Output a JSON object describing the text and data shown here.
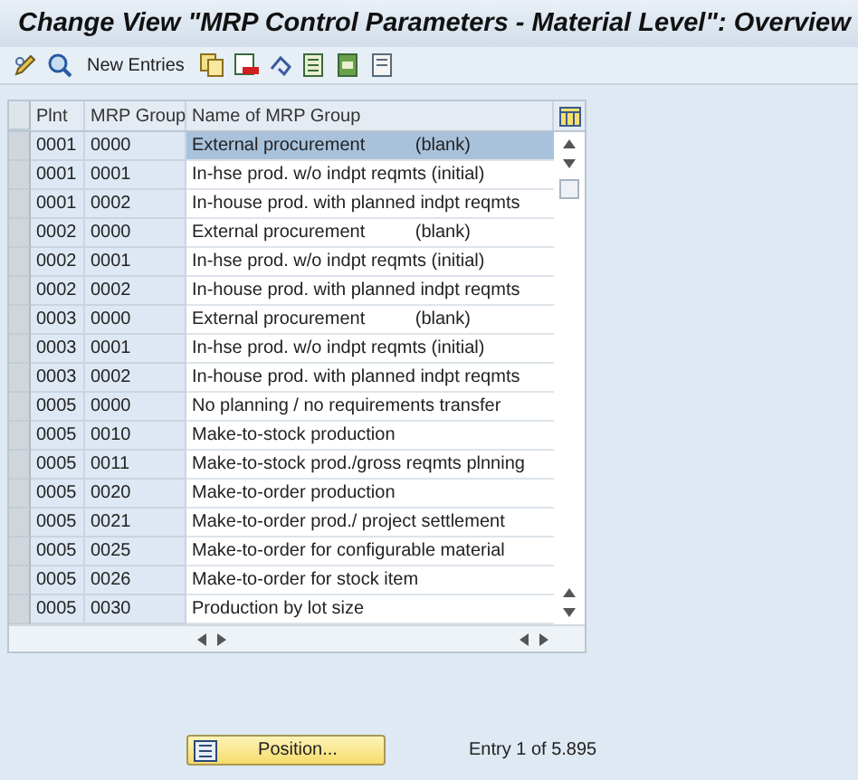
{
  "window": {
    "title": "Change View \"MRP Control Parameters - Material Level\": Overview"
  },
  "toolbar": {
    "new_entries": "New Entries"
  },
  "table": {
    "columns": [
      "Plnt",
      "MRP Group",
      "Name of MRP Group"
    ],
    "rows": [
      {
        "plnt": "0001",
        "group": "0000",
        "name": "External procurement          (blank)",
        "selected": true
      },
      {
        "plnt": "0001",
        "group": "0001",
        "name": "In-hse prod. w/o indpt reqmts (initial)",
        "selected": false
      },
      {
        "plnt": "0001",
        "group": "0002",
        "name": "In-house prod. with planned indpt reqmts",
        "selected": false
      },
      {
        "plnt": "0002",
        "group": "0000",
        "name": "External procurement          (blank)",
        "selected": false
      },
      {
        "plnt": "0002",
        "group": "0001",
        "name": "In-hse prod. w/o indpt reqmts (initial)",
        "selected": false
      },
      {
        "plnt": "0002",
        "group": "0002",
        "name": "In-house prod. with planned indpt reqmts",
        "selected": false
      },
      {
        "plnt": "0003",
        "group": "0000",
        "name": "External procurement          (blank)",
        "selected": false
      },
      {
        "plnt": "0003",
        "group": "0001",
        "name": "In-hse prod. w/o indpt reqmts (initial)",
        "selected": false
      },
      {
        "plnt": "0003",
        "group": "0002",
        "name": "In-house prod. with planned indpt reqmts",
        "selected": false
      },
      {
        "plnt": "0005",
        "group": "0000",
        "name": "No planning / no requirements transfer",
        "selected": false
      },
      {
        "plnt": "0005",
        "group": "0010",
        "name": "Make-to-stock production",
        "selected": false
      },
      {
        "plnt": "0005",
        "group": "0011",
        "name": "Make-to-stock prod./gross reqmts plnning",
        "selected": false
      },
      {
        "plnt": "0005",
        "group": "0020",
        "name": "Make-to-order production",
        "selected": false
      },
      {
        "plnt": "0005",
        "group": "0021",
        "name": "Make-to-order prod./ project settlement",
        "selected": false
      },
      {
        "plnt": "0005",
        "group": "0025",
        "name": "Make-to-order for configurable material",
        "selected": false
      },
      {
        "plnt": "0005",
        "group": "0026",
        "name": "Make-to-order for stock item",
        "selected": false
      },
      {
        "plnt": "0005",
        "group": "0030",
        "name": "Production by lot size",
        "selected": false
      }
    ]
  },
  "footer": {
    "position_button": "Position...",
    "entry": "Entry 1 of 5.895"
  }
}
